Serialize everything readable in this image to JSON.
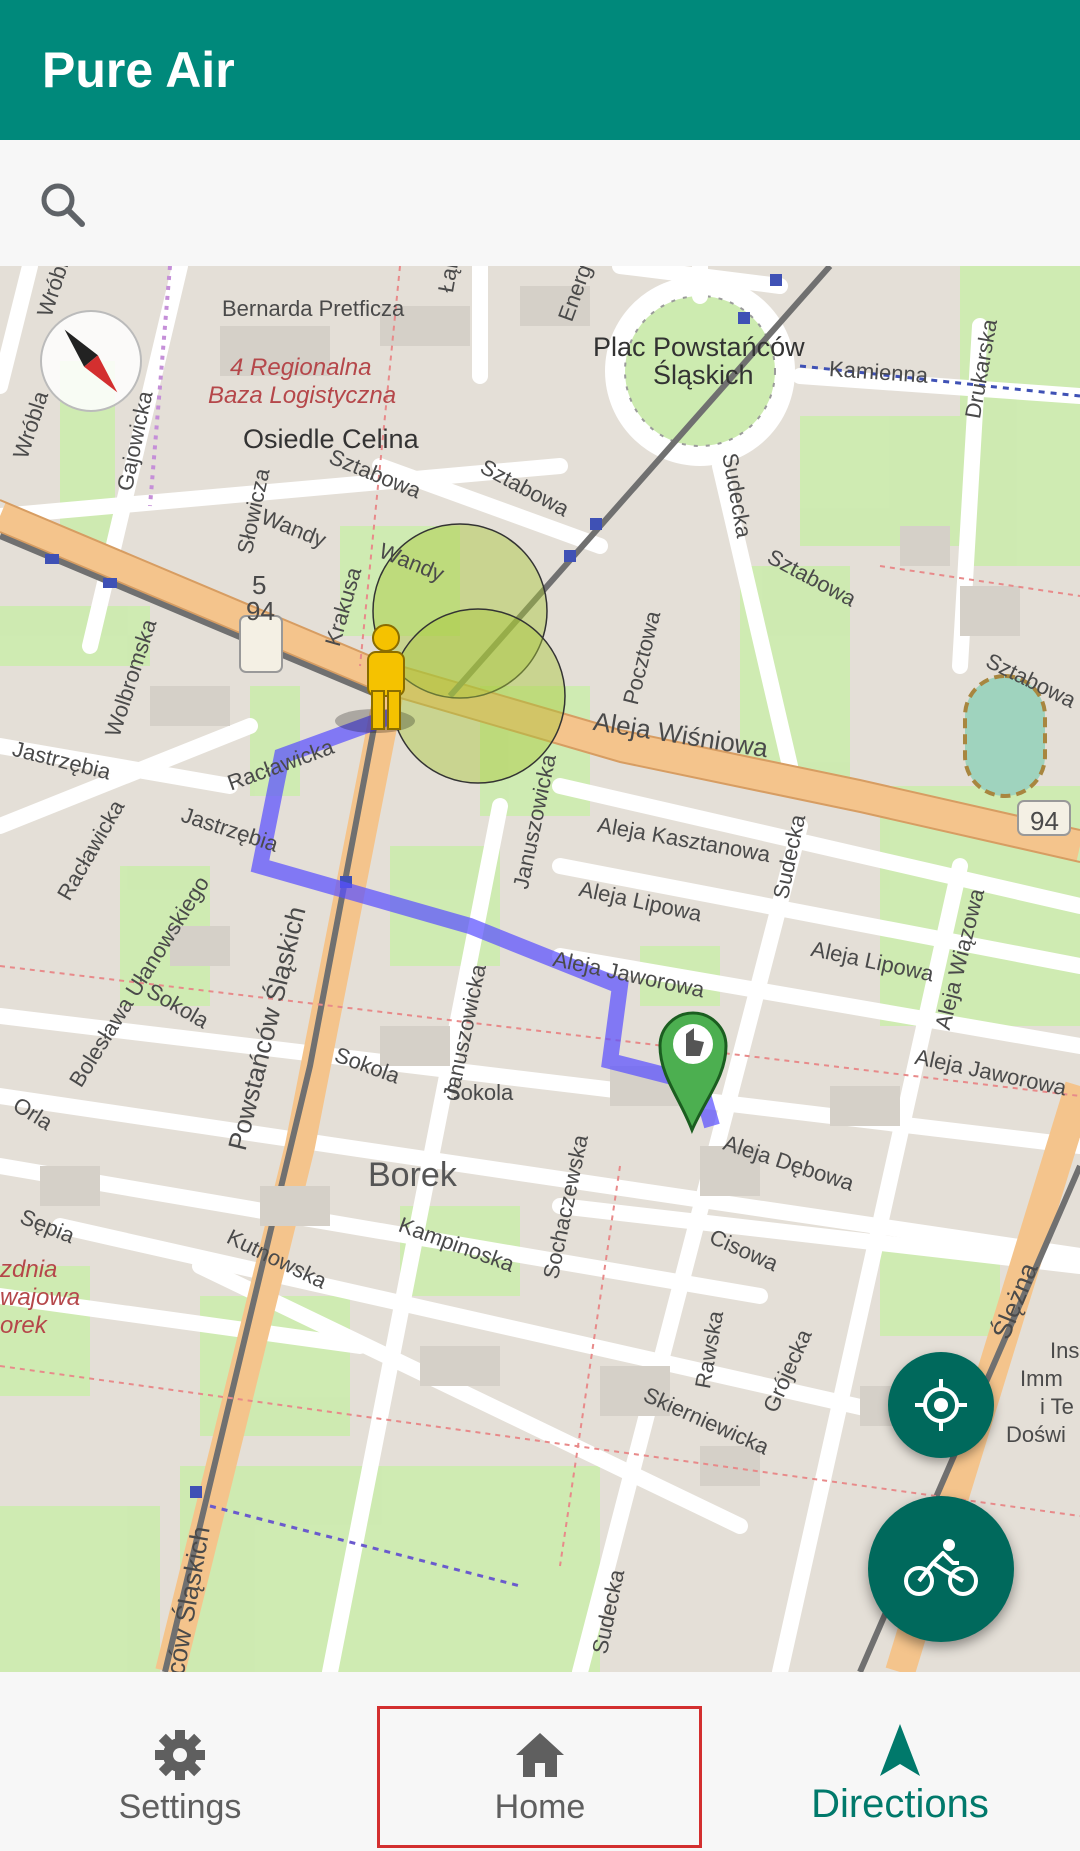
{
  "app": {
    "title": "Pure Air"
  },
  "search": {
    "icon": "search-icon"
  },
  "map": {
    "labels": {
      "bernarda": "Bernarda Pretficza",
      "regional1": "4 Regionalna",
      "regional2": "Baza Logistyczna",
      "osiedle": "Osiedle Celina",
      "plac1": "Plac Powstańców",
      "plac2": "Śląskich",
      "kamienna": "Kamienna",
      "drukarska": "Drukarska",
      "sztabowa1": "Sztabowa",
      "sztabowa2": "Sztabowa",
      "sztabowa3": "Sztabowa",
      "sztabowa4": "Sztabowa",
      "sudecka1": "Sudecka",
      "sudecka2": "Sudecka",
      "sudecka3": "Sudecka",
      "wandy1": "Wandy",
      "wandy2": "Wandy",
      "gajowicka": "Gajowicka",
      "wrobla1": "Wróbla",
      "wrobla2": "Wróbla",
      "slowicza": "Słowicza",
      "krakusa": "Krakusa",
      "energetyczna": "Energetyczna",
      "lak": "Łąk",
      "shield_5": "5",
      "shield_94a": "94",
      "shield_94b": "94",
      "wolbromska": "Wolbromska",
      "jastrzebia1": "Jastrzębia",
      "jastrzebia2": "Jastrzębia",
      "raclawicka1": "Racławicka",
      "raclawicka2": "Racławicka",
      "pocztowa": "Pocztowa",
      "wisniowa": "Aleja Wiśniowa",
      "kasztanowa": "Aleja Kasztanowa",
      "lipowa1": "Aleja Lipowa",
      "lipowa2": "Aleja Lipowa",
      "jaworowa1": "Aleja Jaworowa",
      "jaworowa2": "Aleja Jaworowa",
      "wiazowa": "Aleja Wiązowa",
      "januszowicka1": "Januszowicka",
      "januszowicka2": "Januszowicka",
      "ulanowskiego": "Bolesława Ułanowskiego",
      "sokola1": "Sokola",
      "sokola2": "Sokola",
      "sokola3": "Sokola",
      "orla": "Orla",
      "powstancow1": "Powstańców Śląskich",
      "powstancow2": "ców Śląskich",
      "debowa": "Aleja Dębowa",
      "borek": "Borek",
      "kampinoska": "Kampinoska",
      "sochaczewska": "Sochaczewska",
      "kutnowska": "Kutnowska",
      "sepia": "Sępia",
      "cisowa": "Cisowa",
      "rawska": "Rawska",
      "grojecka": "Grójecka",
      "skierniewicka": "Skierniewicka",
      "slezna": "Ślężna",
      "zdnia": "zdnia",
      "wajowa": "wajowa",
      "orek": "orek",
      "ins": "Ins",
      "imm": "Imm",
      "te": "i Te",
      "dosw": "Doświ"
    }
  },
  "controls": {
    "compass": "compass-icon",
    "locate": "my-location-icon",
    "mode": "bicycle-icon"
  },
  "bottom_nav": {
    "settings": "Settings",
    "home": "Home",
    "directions": "Directions"
  },
  "colors": {
    "app_bar": "#00897b",
    "fab": "#00695c",
    "route": "#5a50ff",
    "active_nav": "#00796b",
    "highlight": "#d32f2f"
  }
}
